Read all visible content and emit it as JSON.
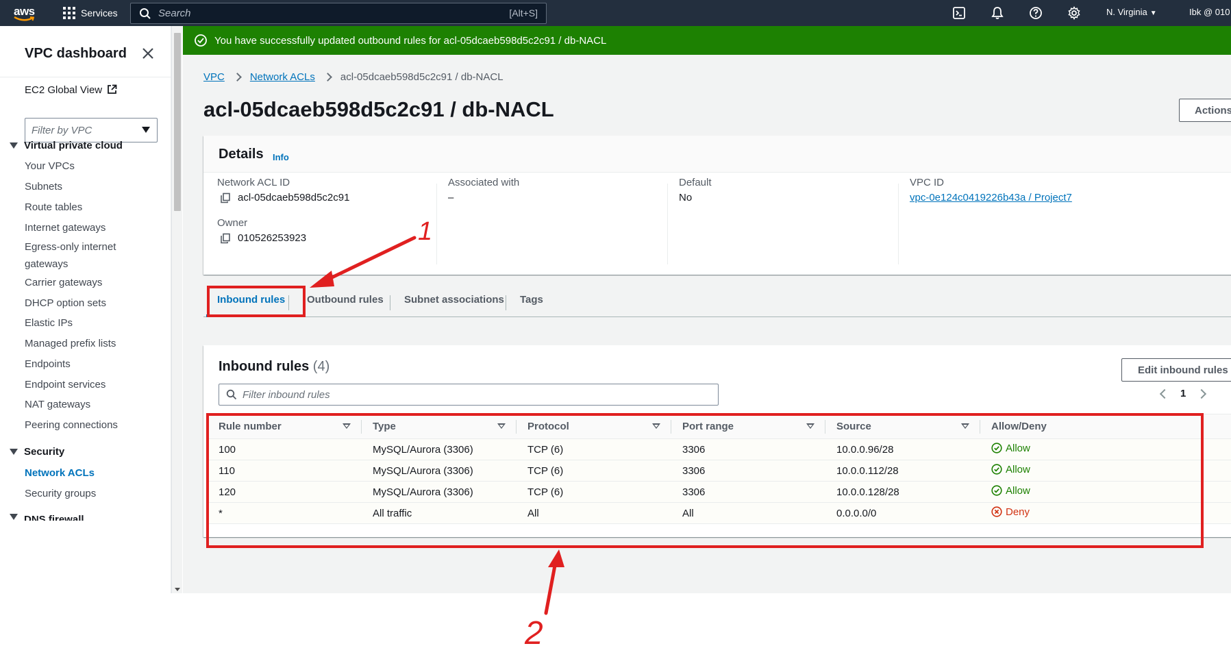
{
  "topbar": {
    "logo_text": "aws",
    "services_label": "Services",
    "search_placeholder": "Search",
    "search_shortcut": "[Alt+S]",
    "region": "N. Virginia",
    "account": "Ibk @ 010",
    "icons": [
      "cloudshell-icon",
      "bell-icon",
      "help-icon",
      "gear-icon"
    ]
  },
  "sidebar": {
    "title": "VPC dashboard",
    "global_view": "EC2 Global View",
    "filter_placeholder": "Filter by VPC",
    "section_vpc": "Virtual private cloud",
    "vpc_items": [
      "Your VPCs",
      "Subnets",
      "Route tables",
      "Internet gateways",
      "Egress-only internet gateways",
      "Carrier gateways",
      "DHCP option sets",
      "Elastic IPs",
      "Managed prefix lists",
      "Endpoints",
      "Endpoint services",
      "NAT gateways",
      "Peering connections"
    ],
    "section_security": "Security",
    "security_items": [
      "Network ACLs",
      "Security groups"
    ],
    "next_section_partial": "DNS firewall"
  },
  "flash": {
    "message": "You have successfully updated outbound rules for acl-05dcaeb598d5c2c91 / db-NACL"
  },
  "breadcrumb": {
    "items": [
      "VPC",
      "Network ACLs",
      "acl-05dcaeb598d5c2c91 / db-NACL"
    ]
  },
  "page": {
    "title": "acl-05dcaeb598d5c2c91 / db-NACL",
    "actions_label": "Actions"
  },
  "details": {
    "title": "Details",
    "info": "Info",
    "network_acl_id_label": "Network ACL ID",
    "network_acl_id": "acl-05dcaeb598d5c2c91",
    "owner_label": "Owner",
    "owner": "010526253923",
    "associated_label": "Associated with",
    "associated": "–",
    "default_label": "Default",
    "default": "No",
    "vpc_id_label": "VPC ID",
    "vpc_id": "vpc-0e124c0419226b43a / Project7"
  },
  "tabs": [
    "Inbound rules",
    "Outbound rules",
    "Subnet associations",
    "Tags"
  ],
  "inbound": {
    "title": "Inbound rules",
    "count": "(4)",
    "edit_label": "Edit inbound rules",
    "filter_placeholder": "Filter inbound rules",
    "page": "1",
    "columns": [
      "Rule number",
      "Type",
      "Protocol",
      "Port range",
      "Source",
      "Allow/Deny"
    ],
    "rows": [
      {
        "rule": "100",
        "type": "MySQL/Aurora (3306)",
        "protocol": "TCP (6)",
        "port": "3306",
        "source": "10.0.0.96/28",
        "action": "Allow"
      },
      {
        "rule": "110",
        "type": "MySQL/Aurora (3306)",
        "protocol": "TCP (6)",
        "port": "3306",
        "source": "10.0.0.112/28",
        "action": "Allow"
      },
      {
        "rule": "120",
        "type": "MySQL/Aurora (3306)",
        "protocol": "TCP (6)",
        "port": "3306",
        "source": "10.0.0.128/28",
        "action": "Allow"
      },
      {
        "rule": "*",
        "type": "All traffic",
        "protocol": "All",
        "port": "All",
        "source": "0.0.0.0/0",
        "action": "Deny"
      }
    ]
  },
  "annotations": {
    "label_1": "1",
    "label_2": "2"
  },
  "colors": {
    "nav_bg": "#232f3e",
    "success": "#1d8102",
    "link": "#0073bb",
    "deny": "#d13212",
    "annotation": "#e02020"
  }
}
